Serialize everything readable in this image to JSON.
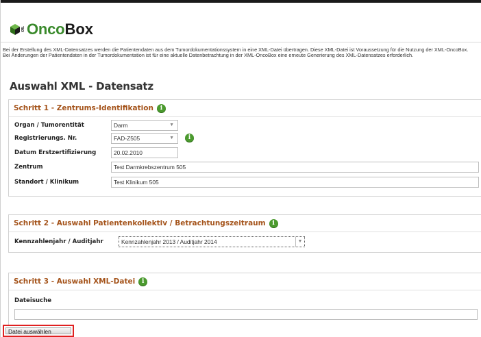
{
  "logo": {
    "xml": "XML",
    "onco": "Onco",
    "box": "Box"
  },
  "intro_text": "Bei der Erstellung des XML-Datensatzes werden die Patientendaten aus dem Tumordokumentationssystem in eine XML-Datei übertragen. Diese XML-Datei ist Voraussetzung für die Nutzung der XML-OncoBox.  Bei Änderungen der Patientendaten in der Tumordokumentation ist für eine aktuelle Datenbetrachtung in der XML-OncoBox eine erneute Generierung des XML-Datensatzes erforderlich.",
  "page_title": "Auswahl XML - Datensatz",
  "step1": {
    "title": "Schritt 1 - Zentrums-Identifikation",
    "organ_label": "Organ / Tumorentität",
    "organ_value": "Darm",
    "reg_label": "Registrierungs. Nr.",
    "reg_value": "FAD-Z505",
    "datum_label": "Datum Erstzertifizierung",
    "datum_value": "20.02.2010",
    "zentrum_label": "Zentrum",
    "zentrum_value": "Test Darmkrebszentrum 505",
    "standort_label": "Standort / Klinikum",
    "standort_value": "Test Klinikum 505"
  },
  "step2": {
    "title": "Schritt 2 - Auswahl Patientenkollektiv  /  Betrachtungszeitraum",
    "kennzahl_label": "Kennzahlenjahr / Auditjahr",
    "kennzahl_value": "Kennzahlenjahr 2013 / Auditjahr 2014"
  },
  "step3": {
    "title": "Schritt 3 - Auswahl XML-Datei",
    "dateisuche_label": "Dateisuche",
    "dateisuche_value": "",
    "file_button_label": "Datei auswählen"
  },
  "colors": {
    "accent_title": "#a4531a",
    "logo_green": "#3a8a2c",
    "highlight": "#e02020",
    "info_icon": "#4b9a2e"
  },
  "icons": {
    "info": "info-icon",
    "dropdown": "chevron-down-icon",
    "logo": "cube-icon"
  }
}
